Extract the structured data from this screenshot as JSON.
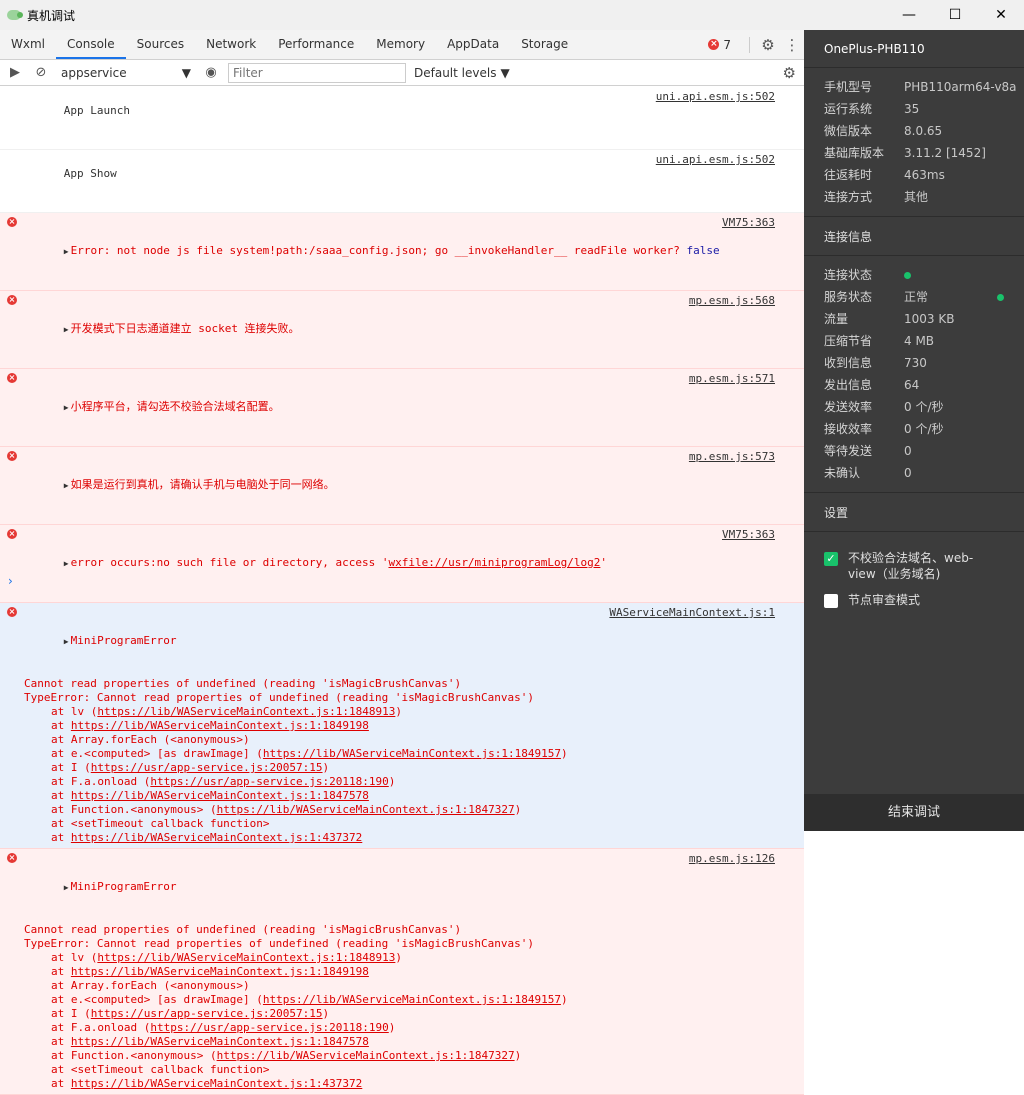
{
  "window": {
    "title": "真机调试",
    "minimize": "—",
    "maximize": "☐",
    "close": "✕"
  },
  "tabs": [
    "Wxml",
    "Console",
    "Sources",
    "Network",
    "Performance",
    "Memory",
    "AppData",
    "Storage"
  ],
  "tabbar": {
    "error_count": "7"
  },
  "toolbar": {
    "context": "appservice",
    "filter_placeholder": "Filter",
    "levels": "Default levels"
  },
  "console": {
    "info": [
      {
        "text": "App Launch",
        "src": "uni.api.esm.js:502"
      },
      {
        "text": "App Show",
        "src": "uni.api.esm.js:502"
      }
    ],
    "errors": [
      {
        "pre": "Error: not node js file system!path:/saaa_config.json; go __invokeHandler__ readFile worker? ",
        "suffix": "false",
        "src": "VM75:363"
      },
      {
        "text": "开发模式下日志通道建立 socket 连接失败。",
        "src": "mp.esm.js:568"
      },
      {
        "text": "小程序平台，请勾选不校验合法域名配置。",
        "src": "mp.esm.js:571"
      },
      {
        "text": "如果是运行到真机，请确认手机与电脑处于同一网络。",
        "src": "mp.esm.js:573"
      },
      {
        "pre": "error occurs:no such file or directory, access '",
        "link": "wxfile://usr/miniprogramLog/log2",
        "post": "'",
        "src": "VM75:363"
      }
    ],
    "mini1": {
      "title": "MiniProgramError",
      "src": "WAServiceMainContext.js:1",
      "line1": "Cannot read properties of undefined (reading 'isMagicBrushCanvas')",
      "line2": "TypeError: Cannot read properties of undefined (reading 'isMagicBrushCanvas')",
      "stack": [
        {
          "a": "at lv (",
          "l": "https://lib/WAServiceMainContext.js:1:1848913",
          "b": ")"
        },
        {
          "a": "at ",
          "l": "https://lib/WAServiceMainContext.js:1:1849198",
          "b": ""
        },
        {
          "a": "at Array.forEach (<anonymous>)",
          "l": "",
          "b": ""
        },
        {
          "a": "at e.<computed> [as drawImage] (",
          "l": "https://lib/WAServiceMainContext.js:1:1849157",
          "b": ")"
        },
        {
          "a": "at I (",
          "l": "https://usr/app-service.js:20057:15",
          "b": ")"
        },
        {
          "a": "at F.a.onload (",
          "l": "https://usr/app-service.js:20118:190",
          "b": ")"
        },
        {
          "a": "at ",
          "l": "https://lib/WAServiceMainContext.js:1:1847578",
          "b": ""
        },
        {
          "a": "at Function.<anonymous> (",
          "l": "https://lib/WAServiceMainContext.js:1:1847327",
          "b": ")"
        },
        {
          "a": "at <setTimeout callback function>",
          "l": "",
          "b": ""
        },
        {
          "a": "at ",
          "l": "https://lib/WAServiceMainContext.js:1:437372",
          "b": ""
        }
      ]
    },
    "mini2": {
      "title": "MiniProgramError",
      "src": "mp.esm.js:126",
      "line1": "Cannot read properties of undefined (reading 'isMagicBrushCanvas')",
      "line2": "TypeError: Cannot read properties of undefined (reading 'isMagicBrushCanvas')",
      "stack": [
        {
          "a": "at lv (",
          "l": "https://lib/WAServiceMainContext.js:1:1848913",
          "b": ")"
        },
        {
          "a": "at ",
          "l": "https://lib/WAServiceMainContext.js:1:1849198",
          "b": ""
        },
        {
          "a": "at Array.forEach (<anonymous>)",
          "l": "",
          "b": ""
        },
        {
          "a": "at e.<computed> [as drawImage] (",
          "l": "https://lib/WAServiceMainContext.js:1:1849157",
          "b": ")"
        },
        {
          "a": "at I (",
          "l": "https://usr/app-service.js:20057:15",
          "b": ")"
        },
        {
          "a": "at F.a.onload (",
          "l": "https://usr/app-service.js:20118:190",
          "b": ")"
        },
        {
          "a": "at ",
          "l": "https://lib/WAServiceMainContext.js:1:1847578",
          "b": ""
        },
        {
          "a": "at Function.<anonymous> (",
          "l": "https://lib/WAServiceMainContext.js:1:1847327",
          "b": ")"
        },
        {
          "a": "at <setTimeout callback function>",
          "l": "",
          "b": ""
        },
        {
          "a": "at ",
          "l": "https://lib/WAServiceMainContext.js:1:437372",
          "b": ""
        }
      ]
    },
    "prompt": "›"
  },
  "side": {
    "device": "OnePlus-PHB110",
    "info": [
      {
        "k": "手机型号",
        "v": "PHB110arm64-v8a"
      },
      {
        "k": "运行系统",
        "v": "35"
      },
      {
        "k": "微信版本",
        "v": "8.0.65"
      },
      {
        "k": "基础库版本",
        "v": "3.11.2 [1452]"
      },
      {
        "k": "往返耗时",
        "v": "463ms"
      },
      {
        "k": "连接方式",
        "v": "其他"
      }
    ],
    "conn_header": "连接信息",
    "conn": [
      {
        "k": "连接状态",
        "v": ""
      },
      {
        "k": "服务状态",
        "v": "正常"
      },
      {
        "k": "流量",
        "v": "1003 KB"
      },
      {
        "k": "压缩节省",
        "v": "4 MB"
      },
      {
        "k": "收到信息",
        "v": "730"
      },
      {
        "k": "发出信息",
        "v": "64"
      },
      {
        "k": "发送效率",
        "v": "0 个/秒"
      },
      {
        "k": "接收效率",
        "v": "0 个/秒"
      },
      {
        "k": "等待发送",
        "v": "0"
      },
      {
        "k": "未确认",
        "v": "0"
      }
    ],
    "settings_header": "设置",
    "opt1": "不校验合法域名、web-view（业务域名)",
    "opt2": "节点审查模式",
    "end_button": "结束调试",
    "status_color": "#19c26b"
  }
}
